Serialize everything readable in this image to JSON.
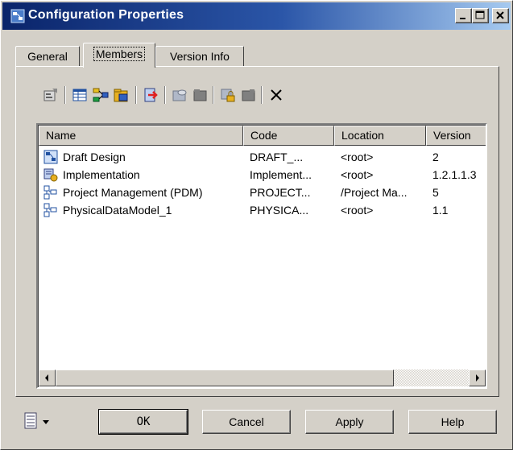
{
  "window": {
    "title": "Configuration Properties"
  },
  "tabs": [
    {
      "label": "General"
    },
    {
      "label": "Members"
    },
    {
      "label": "Version Info"
    }
  ],
  "toolbar": {
    "icons": [
      "properties-icon",
      "add-rows-icon",
      "add-objects-icon",
      "add-package-icon",
      "delete-model-icon",
      "folder-icon",
      "folder-dark-icon",
      "lock-icon",
      "unlock-icon",
      "delete-icon"
    ]
  },
  "list": {
    "columns": [
      "Name",
      "Code",
      "Location",
      "Version"
    ],
    "rows": [
      {
        "name": "Draft Design",
        "code": "DRAFT_...",
        "location": "<root>",
        "version": "2",
        "icon": "model-icon"
      },
      {
        "name": "Implementation",
        "code": "Implement...",
        "location": "<root>",
        "version": "1.2.1.1.3",
        "icon": "implementation-icon"
      },
      {
        "name": "Project Management (PDM)",
        "code": "PROJECT...",
        "location": "/Project Ma...",
        "version": "5",
        "icon": "physical-model-icon"
      },
      {
        "name": "PhysicalDataModel_1",
        "code": "PHYSICA...",
        "location": "<root>",
        "version": "1.1",
        "icon": "physical-model-icon"
      }
    ]
  },
  "buttons": {
    "ok": "OK",
    "cancel": "Cancel",
    "apply": "Apply",
    "help": "Help"
  },
  "colors": {
    "titlebar_start": "#0a246a",
    "titlebar_end": "#a6caf0",
    "face": "#d4d0c8"
  }
}
